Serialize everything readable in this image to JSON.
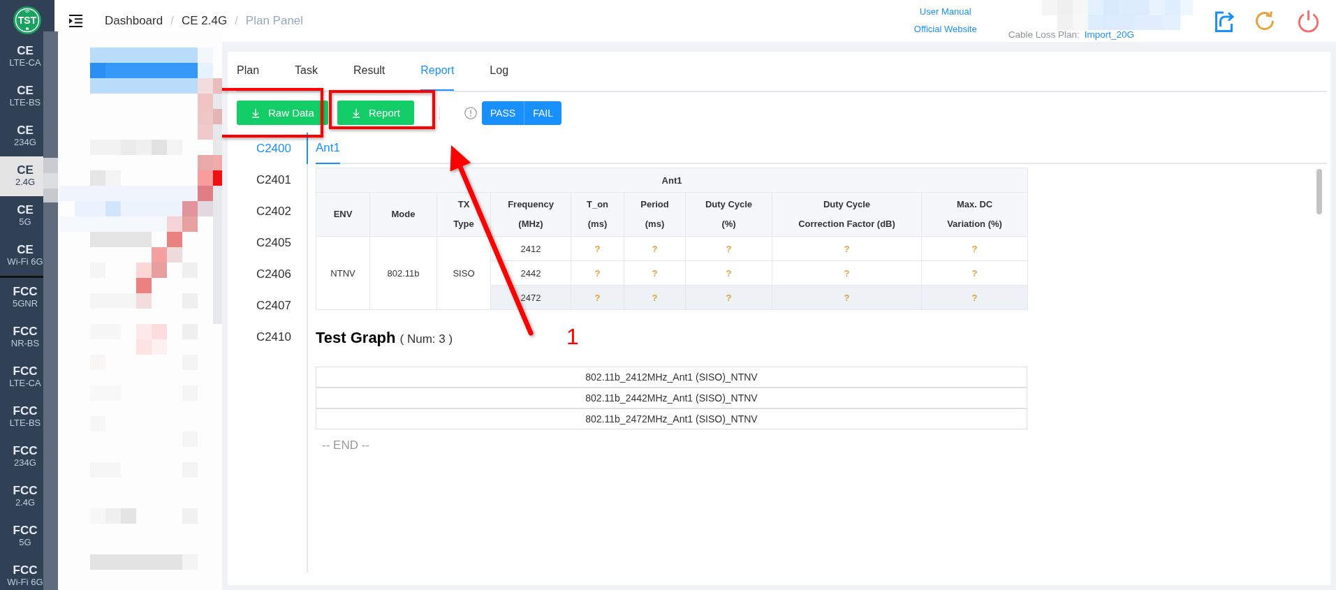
{
  "sidebar": {
    "logo_text": "TST",
    "groups": [
      {
        "items": [
          {
            "title": "CE",
            "subtitle": "LTE-CA",
            "selected": false
          },
          {
            "title": "CE",
            "subtitle": "LTE-BS",
            "selected": false
          },
          {
            "title": "CE",
            "subtitle": "234G",
            "selected": false
          },
          {
            "title": "CE",
            "subtitle": "2.4G",
            "selected": true
          },
          {
            "title": "CE",
            "subtitle": "5G",
            "selected": false
          },
          {
            "title": "CE",
            "subtitle": "Wi-Fi 6G",
            "selected": false
          }
        ]
      },
      {
        "items": [
          {
            "title": "FCC",
            "subtitle": "5GNR",
            "selected": false
          },
          {
            "title": "FCC",
            "subtitle": "NR-BS",
            "selected": false
          },
          {
            "title": "FCC",
            "subtitle": "LTE-CA",
            "selected": false
          },
          {
            "title": "FCC",
            "subtitle": "LTE-BS",
            "selected": false
          },
          {
            "title": "FCC",
            "subtitle": "234G",
            "selected": false
          },
          {
            "title": "FCC",
            "subtitle": "2.4G",
            "selected": false
          },
          {
            "title": "FCC",
            "subtitle": "5G",
            "selected": false
          },
          {
            "title": "FCC",
            "subtitle": "Wi-Fi 6G",
            "selected": false
          }
        ]
      }
    ]
  },
  "header": {
    "breadcrumb": [
      {
        "label": "Dashboard",
        "separator": "/",
        "current": false
      },
      {
        "label": "CE 2.4G",
        "separator": "/",
        "current": false
      },
      {
        "label": "Plan Panel",
        "current": true
      }
    ],
    "links": [
      {
        "label": "User Manual"
      },
      {
        "label": "Official Website"
      }
    ],
    "cable_loss_plan": {
      "label": "Cable Loss Plan:",
      "value": "Import_20G"
    }
  },
  "tabs": [
    {
      "label": "Plan",
      "selected": false
    },
    {
      "label": "Task",
      "selected": false
    },
    {
      "label": "Result",
      "selected": false
    },
    {
      "label": "Report",
      "selected": true
    },
    {
      "label": "Log",
      "selected": false
    }
  ],
  "toolbar": {
    "downloads": [
      {
        "label": "Raw Data"
      },
      {
        "label": "Report"
      }
    ],
    "result_filter": [
      {
        "label": "PASS"
      },
      {
        "label": "FAIL"
      }
    ]
  },
  "case_list": [
    {
      "label": "C2400",
      "selected": true
    },
    {
      "label": "C2401",
      "selected": false
    },
    {
      "label": "C2402",
      "selected": false
    },
    {
      "label": "C2405",
      "selected": false
    },
    {
      "label": "C2406",
      "selected": false
    },
    {
      "label": "C2407",
      "selected": false
    },
    {
      "label": "C2410",
      "selected": false
    }
  ],
  "sub_tabs": [
    {
      "label": "Ant1",
      "selected": true
    }
  ],
  "table": {
    "title": "Ant1",
    "columns": [
      {
        "lines": [
          "ENV"
        ]
      },
      {
        "lines": [
          "Mode"
        ]
      },
      {
        "lines": [
          "TX",
          "Type"
        ]
      },
      {
        "lines": [
          "Frequency",
          "(MHz)"
        ]
      },
      {
        "lines": [
          "T_on",
          "(ms)"
        ]
      },
      {
        "lines": [
          "Period",
          "(ms)"
        ]
      },
      {
        "lines": [
          "Duty Cycle",
          "(%)"
        ]
      },
      {
        "lines": [
          "Duty Cycle",
          "Correction Factor (dB)"
        ]
      },
      {
        "lines": [
          "Max. DC",
          "Variation (%)"
        ]
      }
    ],
    "groups": [
      {
        "env": "NTNV",
        "mode": "802.11b",
        "tx_type": "SISO",
        "rows": [
          {
            "cells": [
              "2412",
              "?",
              "?",
              "?",
              "?",
              "?"
            ],
            "highlighted": false
          },
          {
            "cells": [
              "2442",
              "?",
              "?",
              "?",
              "?",
              "?"
            ],
            "highlighted": false
          },
          {
            "cells": [
              "2472",
              "?",
              "?",
              "?",
              "?",
              "?"
            ],
            "highlighted": true
          }
        ]
      }
    ]
  },
  "test_graph": {
    "title": "Test Graph",
    "count": "( Num: 3 )",
    "items": [
      {
        "label": "802.11b_2412MHz_Ant1 (SISO)_NTNV"
      },
      {
        "label": "802.11b_2442MHz_Ant1 (SISO)_NTNV"
      },
      {
        "label": "802.11b_2472MHz_Ant1 (SISO)_NTNV"
      }
    ]
  },
  "end_marker": "-- END --",
  "annotation": {
    "label": "1"
  }
}
